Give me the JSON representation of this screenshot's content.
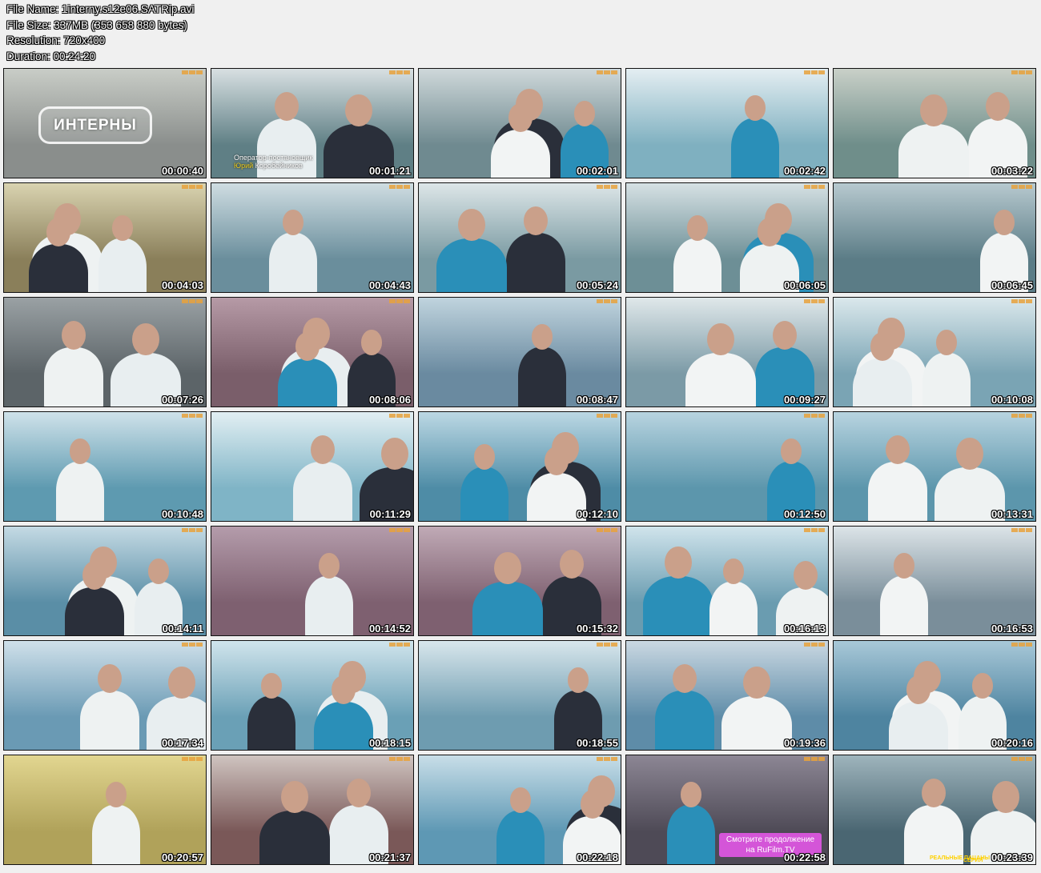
{
  "info": {
    "file_name": "File Name: 1interny.s12e06.SATRip.avi",
    "file_size": "File Size: 337MB (353 658 880 bytes)",
    "resolution": "Resolution: 720x400",
    "duration": "Duration: 00:24:20"
  },
  "overlays": {
    "title_card": "ИНТЕРНЫ",
    "credit_role": "Оператор-постановщик",
    "credit_first": "Юрий",
    "credit_last": "Коробейников",
    "promo_line1": "Смотрите продолжение",
    "promo_line2": "на RuFilm.TV",
    "promo_foot_left": "РЕАЛЬНЫЕ ПАЦАНЫ",
    "promo_foot_right": "СЕРИЯ"
  },
  "thumbnails": [
    {
      "time": "00:00:40",
      "bg": "#8a8e8c",
      "wall": "#c9cdc7"
    },
    {
      "time": "00:01:21",
      "bg": "#5f7f85",
      "wall": "#d8e0e2"
    },
    {
      "time": "00:02:01",
      "bg": "#6f8a90",
      "wall": "#cfd8da"
    },
    {
      "time": "00:02:42",
      "bg": "#7fb0c0",
      "wall": "#e4eef2"
    },
    {
      "time": "00:03:22",
      "bg": "#6f8e8a",
      "wall": "#c9d0c8"
    },
    {
      "time": "00:04:03",
      "bg": "#8a7f5a",
      "wall": "#d9d3b0"
    },
    {
      "time": "00:04:43",
      "bg": "#6a8e9c",
      "wall": "#cfdde2"
    },
    {
      "time": "00:05:24",
      "bg": "#7a9aa2",
      "wall": "#dde6e8"
    },
    {
      "time": "00:06:05",
      "bg": "#6d8f96",
      "wall": "#d6e1e4"
    },
    {
      "time": "00:06:45",
      "bg": "#5b7c86",
      "wall": "#b7c9cf"
    },
    {
      "time": "00:07:26",
      "bg": "#5c6468",
      "wall": "#9aa1a4"
    },
    {
      "time": "00:08:06",
      "bg": "#7a5e6a",
      "wall": "#b69aa6"
    },
    {
      "time": "00:08:47",
      "bg": "#6a8aa0",
      "wall": "#c0d4de"
    },
    {
      "time": "00:09:27",
      "bg": "#7b9aa6",
      "wall": "#e0e8ea"
    },
    {
      "time": "00:10:08",
      "bg": "#7aa4b4",
      "wall": "#dbe8ec"
    },
    {
      "time": "00:10:48",
      "bg": "#5e9ab0",
      "wall": "#cfe2ea"
    },
    {
      "time": "00:11:29",
      "bg": "#7fb4c6",
      "wall": "#e2eff3"
    },
    {
      "time": "00:12:10",
      "bg": "#4e8ca6",
      "wall": "#bcd8e4"
    },
    {
      "time": "00:12:50",
      "bg": "#5c96ac",
      "wall": "#b8d4e0"
    },
    {
      "time": "00:13:31",
      "bg": "#5c96ac",
      "wall": "#b8d4e0"
    },
    {
      "time": "00:14:11",
      "bg": "#5a8ea6",
      "wall": "#c4dae4"
    },
    {
      "time": "00:14:52",
      "bg": "#7e6070",
      "wall": "#b49cab"
    },
    {
      "time": "00:15:32",
      "bg": "#7e6070",
      "wall": "#c0aab6"
    },
    {
      "time": "00:16:13",
      "bg": "#6a9cb0",
      "wall": "#d0e4ec"
    },
    {
      "time": "00:16:53",
      "bg": "#7a8e9a",
      "wall": "#dce4e8"
    },
    {
      "time": "00:17:34",
      "bg": "#6a9ab4",
      "wall": "#cfe0ea"
    },
    {
      "time": "00:18:15",
      "bg": "#6aa0b6",
      "wall": "#d0e4ec"
    },
    {
      "time": "00:18:55",
      "bg": "#6e9cb0",
      "wall": "#d8e6ec"
    },
    {
      "time": "00:19:36",
      "bg": "#5e8ca8",
      "wall": "#cad8e2"
    },
    {
      "time": "00:20:16",
      "bg": "#4e84a0",
      "wall": "#a8c8d8"
    },
    {
      "time": "00:20:57",
      "bg": "#b0a25a",
      "wall": "#e2d690"
    },
    {
      "time": "00:21:37",
      "bg": "#7a5858",
      "wall": "#cfc4c0"
    },
    {
      "time": "00:22:18",
      "bg": "#5e98b4",
      "wall": "#c8dee8"
    },
    {
      "time": "00:22:58",
      "bg": "#4e4a56",
      "wall": "#8c8694"
    },
    {
      "time": "00:23:39",
      "bg": "#4a6672",
      "wall": "#9eb4bc"
    }
  ]
}
